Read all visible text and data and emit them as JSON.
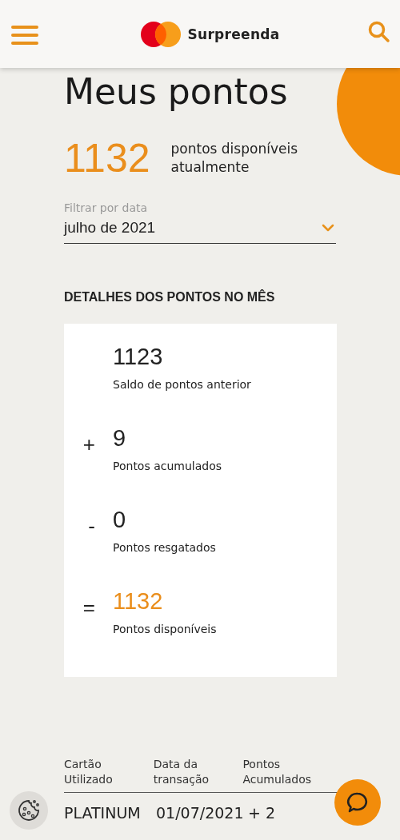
{
  "header": {
    "brand": "Surpreenda"
  },
  "page_title": "Meus pontos",
  "summary": {
    "points": "1132",
    "caption": "pontos disponíveis atualmente"
  },
  "filter": {
    "label": "Filtrar por data",
    "value": "julho de 2021"
  },
  "details": {
    "heading": "DETALHES DOS PONTOS NO MÊS",
    "rows": [
      {
        "sign": "",
        "value": "1123",
        "label": "Saldo de pontos anterior",
        "highlight": false
      },
      {
        "sign": "+",
        "value": "9",
        "label": "Pontos acumulados",
        "highlight": false
      },
      {
        "sign": "-",
        "value": "0",
        "label": "Pontos resgatados",
        "highlight": false
      },
      {
        "sign": "=",
        "value": "1132",
        "label": "Pontos disponíveis",
        "highlight": true
      }
    ]
  },
  "table": {
    "columns": [
      "Cartão Utilizado",
      "Data da transação",
      "Pontos Acumulados"
    ],
    "rows": [
      [
        "PLATINUM",
        "01/07/2021",
        "+ 2"
      ]
    ]
  }
}
